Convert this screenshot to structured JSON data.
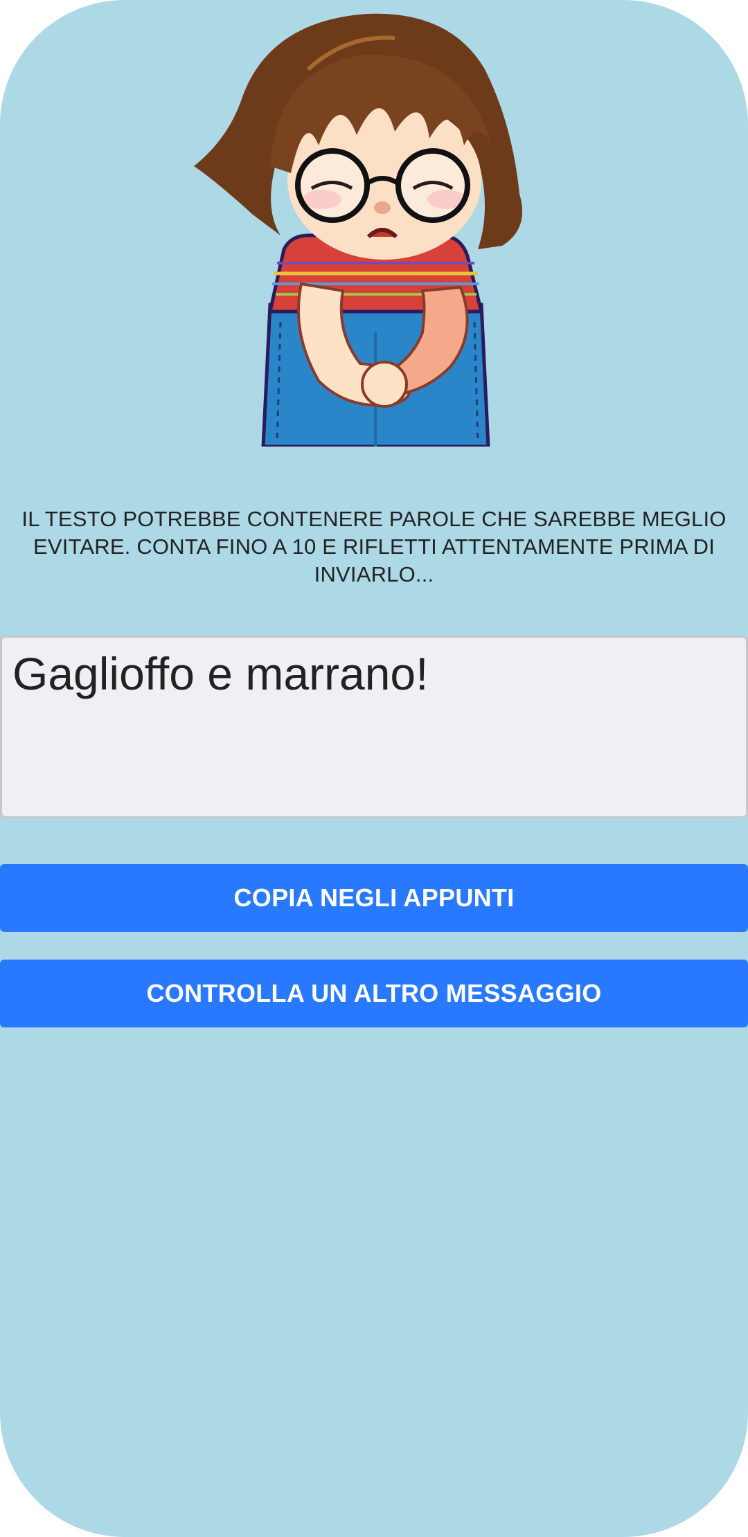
{
  "illustration": {
    "name": "sad-girl-with-glasses"
  },
  "warning": {
    "line1": "IL TESTO POTREBBE CONTENERE PAROLE CHE SAREBBE MEGLIO",
    "line2": "EVITARE. CONTA FINO A 10 E RIFLETTI ATTENTAMENTE PRIMA DI",
    "line3": "INVIARLO..."
  },
  "message": {
    "value": "Gaglioffo e marrano!"
  },
  "buttons": {
    "copy_label": "COPIA NEGLI APPUNTI",
    "check_label": "CONTROLLA UN ALTRO MESSAGGIO"
  },
  "colors": {
    "background": "#add8e6",
    "button": "#2979ff",
    "textbox": "#efeff4"
  }
}
